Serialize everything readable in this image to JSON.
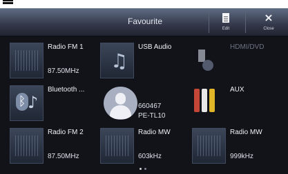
{
  "header": {
    "title": "Favourite",
    "edit_label": "Edit",
    "close_label": "Close"
  },
  "tiles": [
    {
      "label": "Radio FM 1",
      "sub": "87.50MHz",
      "icon": "radio-tile-icon"
    },
    {
      "label": "USB Audio",
      "sub": "",
      "icon": "music-note-icon"
    },
    {
      "label": "HDMI/DVD",
      "sub": "",
      "icon": "hdmi-plug-icon",
      "disabled": true
    },
    {
      "label": "Bluetooth ...",
      "sub": "",
      "icon": "bluetooth-audio-icon"
    },
    {
      "label": "",
      "sub_lines": [
        "660467",
        "PE-TL10"
      ],
      "icon": "contact-person-icon"
    },
    {
      "label": "AUX",
      "sub": "",
      "icon": "rca-connector-icon"
    },
    {
      "label": "Radio FM 2",
      "sub": "87.50MHz",
      "icon": "radio-tile-icon"
    },
    {
      "label": "Radio MW",
      "sub": "603kHz",
      "icon": "radio-tile-icon"
    },
    {
      "label": "Radio MW",
      "sub": "999kHz",
      "icon": "radio-tile-icon"
    }
  ],
  "pagination": {
    "count": 2,
    "active": 1
  },
  "colors": {
    "accent": "#5f6d84",
    "background": "#111319",
    "disabled_text": "#6e7484",
    "aux_red": "#c34636",
    "aux_white": "#e8e8e8",
    "aux_yellow": "#e0b528"
  }
}
